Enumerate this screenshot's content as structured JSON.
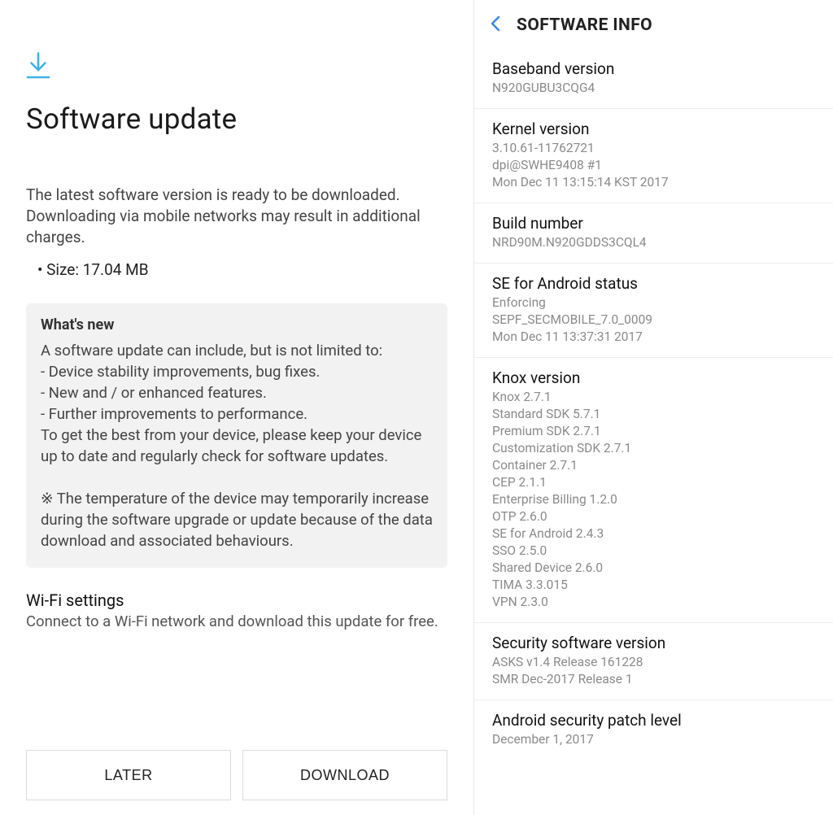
{
  "left": {
    "title": "Software update",
    "intro": "The latest software version is ready to be downloaded. Downloading via mobile networks may result in additional charges.",
    "size_prefix": "• Size: ",
    "size_value": "17.04 MB",
    "whats_new_title": "What's new",
    "whats_new_body": "A software update can include, but is not limited to:\n - Device stability improvements, bug fixes.\n - New and / or enhanced features.\n - Further improvements to performance.\nTo get the best from your device, please keep your device up to date and regularly check for software updates.\n\n※ The temperature of the device may temporarily increase during the software upgrade or update because of the data download and associated behaviours.",
    "wifi_title": "Wi-Fi settings",
    "wifi_sub": "Connect to a Wi-Fi network and download this update for free.",
    "buttons": {
      "later": "LATER",
      "download": "DOWNLOAD"
    }
  },
  "right": {
    "header": "SOFTWARE INFO",
    "items": [
      {
        "title": "Baseband version",
        "sub": "N920GUBU3CQG4"
      },
      {
        "title": "Kernel version",
        "sub": "3.10.61-11762721\ndpi@SWHE9408 #1\nMon Dec 11 13:15:14 KST 2017"
      },
      {
        "title": "Build number",
        "sub": "NRD90M.N920GDDS3CQL4"
      },
      {
        "title": "SE for Android status",
        "sub": "Enforcing\nSEPF_SECMOBILE_7.0_0009\nMon Dec 11 13:37:31 2017"
      },
      {
        "title": "Knox version",
        "sub": "Knox 2.7.1\nStandard SDK 5.7.1\nPremium SDK 2.7.1\nCustomization SDK 2.7.1\nContainer 2.7.1\nCEP 2.1.1\nEnterprise Billing 1.2.0\nOTP 2.6.0\nSE for Android 2.4.3\nSSO 2.5.0\nShared Device 2.6.0\nTIMA 3.3.015\nVPN 2.3.0"
      },
      {
        "title": "Security software version",
        "sub": "ASKS v1.4 Release 161228\nSMR Dec-2017 Release 1"
      },
      {
        "title": "Android security patch level",
        "sub": "December 1, 2017"
      }
    ]
  },
  "colors": {
    "accent": "#3EB2E6"
  }
}
